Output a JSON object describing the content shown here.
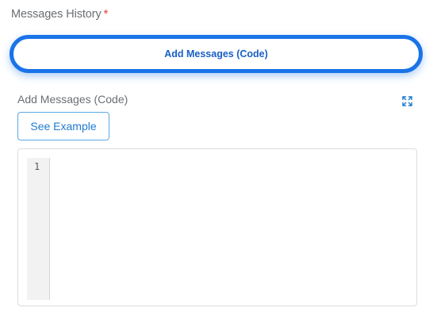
{
  "messages_history": {
    "label": "Messages History",
    "required_mark": "*"
  },
  "add_messages_button": {
    "label": "Add Messages (Code)"
  },
  "code_section": {
    "label": "Add Messages (Code)",
    "expand_icon": "expand-arrows-icon",
    "see_example_label": "See Example"
  },
  "editor": {
    "line_numbers": [
      "1"
    ],
    "content": ""
  },
  "colors": {
    "accent": "#1a73e8",
    "link": "#1f7bd1",
    "required": "#e53935"
  }
}
